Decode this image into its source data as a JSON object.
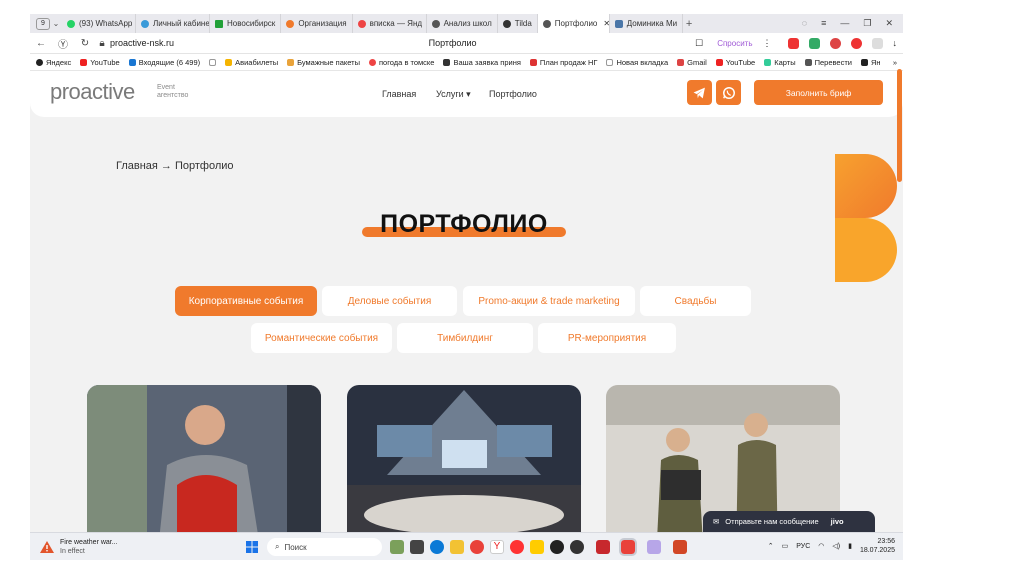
{
  "browser": {
    "tab_count": "9",
    "tabs": [
      {
        "label": "(93) WhatsApp",
        "color": "#25d366"
      },
      {
        "label": "Личный кабинет",
        "color": "#3a9ad9"
      },
      {
        "label": "Новосибирск",
        "color": "#21a038"
      },
      {
        "label": "Организация",
        "color": "#f07a2c"
      },
      {
        "label": "вписка — Янд",
        "color": "#e44"
      },
      {
        "label": "Анализ школ",
        "color": "#555"
      },
      {
        "label": "Tilda",
        "color": "#333"
      },
      {
        "label": "Портфолио",
        "color": "#555"
      },
      {
        "label": "Доминика Ми",
        "color": "#4a76a8"
      }
    ],
    "new_tab_label": "+",
    "url": "proactive-nsk.ru",
    "page_title": "Портфолио",
    "ask_label": "Спросить"
  },
  "bookmarks": [
    {
      "label": "Яндекс",
      "color": "#222"
    },
    {
      "label": "YouTube",
      "color": "#e22"
    },
    {
      "label": "Входящие (6 499)",
      "color": "#1976d2"
    },
    {
      "label": "",
      "color": "#aaa"
    },
    {
      "label": "Авиабилеты",
      "color": "#f5b400"
    },
    {
      "label": "Бумажные пакеты",
      "color": "#e9a33a"
    },
    {
      "label": "погода в томске",
      "color": "#e44"
    },
    {
      "label": "Ваша заявка приня",
      "color": "#333"
    },
    {
      "label": "План продаж НГ",
      "color": "#d33"
    },
    {
      "label": "Новая вкладка",
      "color": "#777"
    },
    {
      "label": "Gmail",
      "color": "#d44"
    },
    {
      "label": "YouTube",
      "color": "#e22"
    },
    {
      "label": "Карты",
      "color": "#3c9"
    },
    {
      "label": "Перевести",
      "color": "#555"
    },
    {
      "label": "Ян",
      "color": "#222"
    }
  ],
  "site": {
    "logo": "proactive",
    "logo_sub_1": "Event",
    "logo_sub_2": "агентство",
    "nav": {
      "home": "Главная",
      "services": "Услуги ▾",
      "portfolio": "Портфолио"
    },
    "brief_button": "Заполнить бриф",
    "accent_color": "#f07a2c"
  },
  "breadcrumb": "Главная → Портфолио",
  "heading": "ПОРТФОЛИО",
  "filters": {
    "corporate": "Корпоративные события",
    "business": "Деловые события",
    "promo": "Promo-акции & trade marketing",
    "weddings": "Свадьбы",
    "romantic": "Романтические события",
    "teambuilding": "Тимбилдинг",
    "pr": "PR-мероприятия"
  },
  "chat": {
    "label": "Отправьте нам сообщение",
    "brand": "jivo"
  },
  "taskbar": {
    "weather_line1": "Fire weather war...",
    "weather_line2": "In effect",
    "search_placeholder": "Поиск",
    "lang": "РУС",
    "time": "23:56",
    "date": "18.07.2025"
  }
}
